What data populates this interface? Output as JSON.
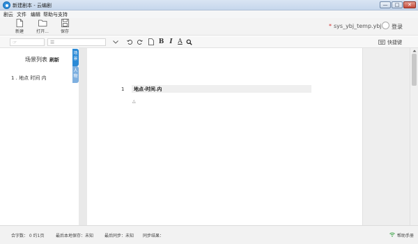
{
  "window": {
    "title": "新建剧本 - 云编剧",
    "min_glyph": "—",
    "max_glyph": "□",
    "close_glyph": "✕"
  },
  "menu": {
    "items": [
      "剧云",
      "文件",
      "编辑",
      "帮助与支持"
    ]
  },
  "toolbar": {
    "new_label": "新建",
    "open_label": "打开...",
    "save_label": "保存",
    "filename": "sys_ybj_temp.ybj",
    "dirty_marker": "*",
    "login_label": "登录"
  },
  "format_bar": {
    "input1_icon": "☞",
    "input2_icon": "☰",
    "bold": "B",
    "italic": "I",
    "underline": "A",
    "keyboard_label": "快捷键"
  },
  "left_panel": {
    "header": "场景列表",
    "refresh": "刷新",
    "items": [
      "1 . 地点 时间 内"
    ]
  },
  "side_tabs": {
    "scene": "场景",
    "person": "人物"
  },
  "editor": {
    "line_number": "1",
    "line_text": "地点-时间.内",
    "caret_mark": "△"
  },
  "status": {
    "total_pages": "合字数： 0 约1页",
    "local_save": "最后本地保存：未知",
    "sync": "最后同步：未知",
    "sync_status": "同步结果：",
    "help": "帮助手册"
  },
  "colors": {
    "accent": "#2b8ad6",
    "tab_secondary": "#7eb0e0",
    "dirty_star": "#d32f2f"
  }
}
